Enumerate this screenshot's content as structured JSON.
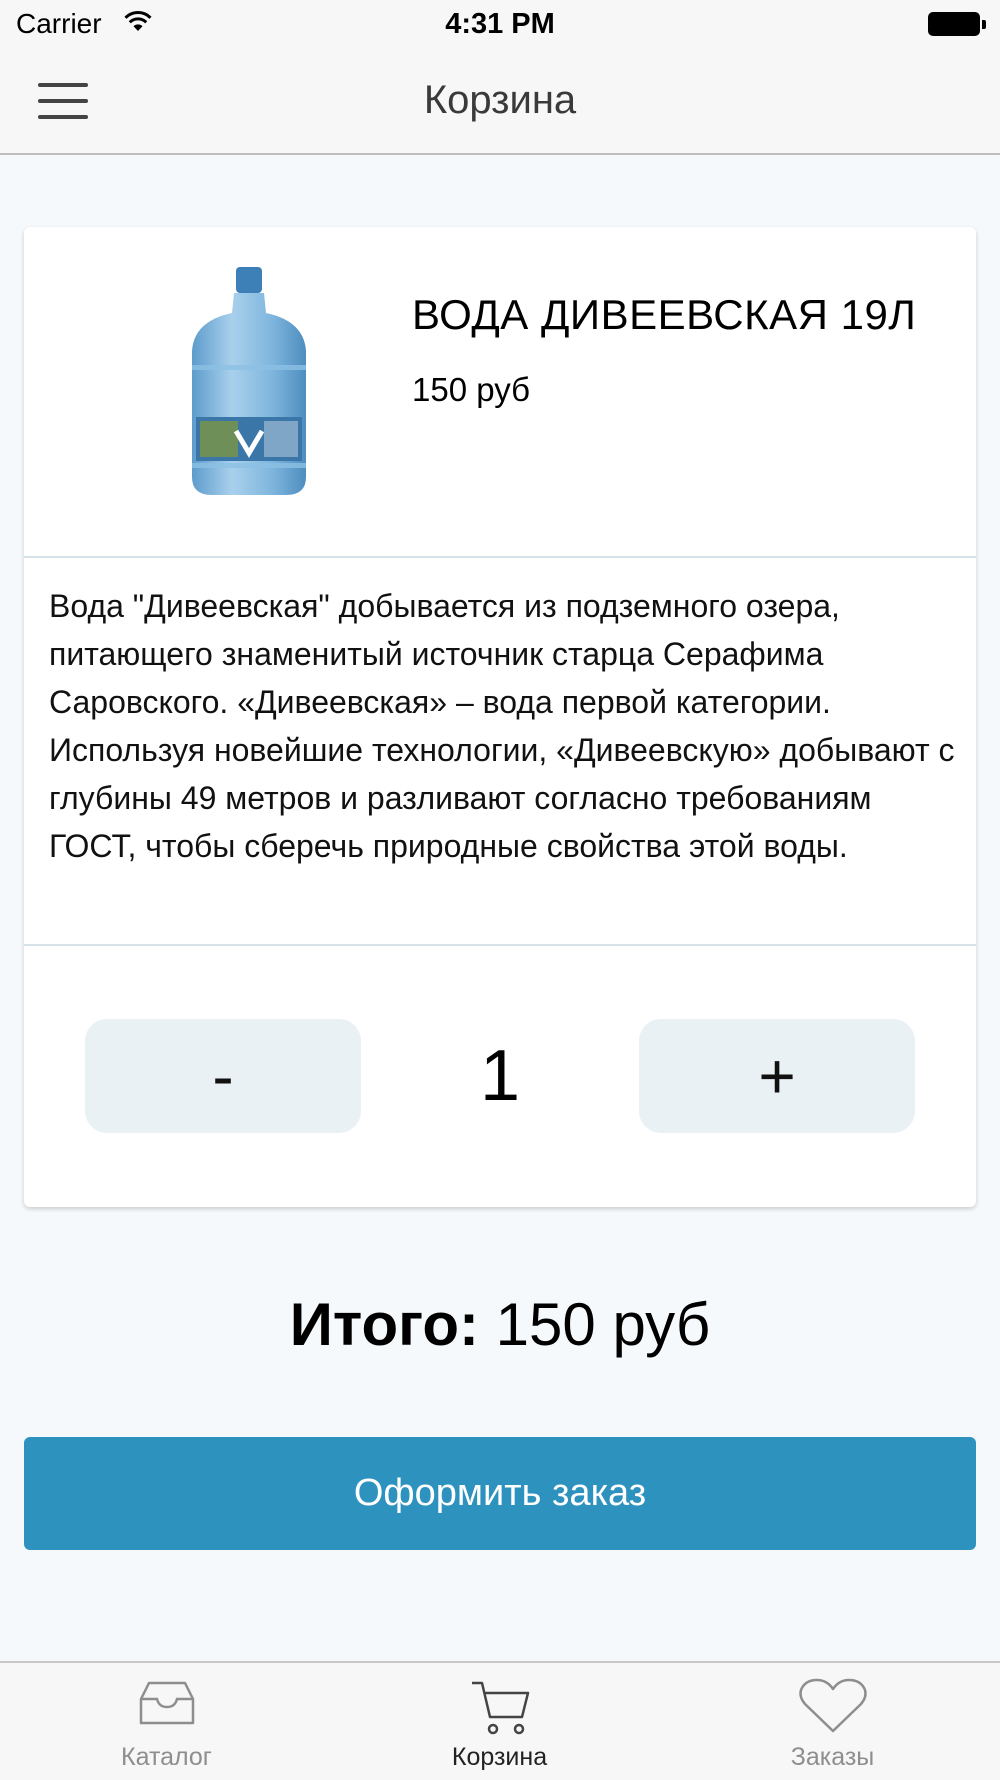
{
  "status_bar": {
    "carrier": "Carrier",
    "time": "4:31 PM"
  },
  "header": {
    "title": "Корзина",
    "menu_icon": "hamburger-menu-icon"
  },
  "cart_item": {
    "name": "ВОДА ДИВЕЕВСКАЯ 19Л",
    "price": "150 руб",
    "image_icon": "water-bottle-image",
    "description": "Вода \"Дивеевская\" добывается из подземного озера, питающего знаменитый источник старца Серафима Саровского. «Дивеевская» – вода первой категории. Используя новейшие технологии, «Дивеевскую» добывают с глубины 49 метров и разливают согласно требованиям ГОСТ, чтобы сберечь природные свойства этой воды.",
    "decrement_label": "-",
    "quantity": "1",
    "increment_label": "+"
  },
  "total": {
    "label": "Итого:",
    "value": "150 руб"
  },
  "checkout": {
    "label": "Оформить заказ",
    "color": "#2e92bf"
  },
  "tab_bar": {
    "tabs": [
      {
        "label": "Каталог",
        "icon": "inbox-tray-icon",
        "active": false
      },
      {
        "label": "Корзина",
        "icon": "cart-icon",
        "active": true
      },
      {
        "label": "Заказы",
        "icon": "heart-icon",
        "active": false
      }
    ]
  }
}
